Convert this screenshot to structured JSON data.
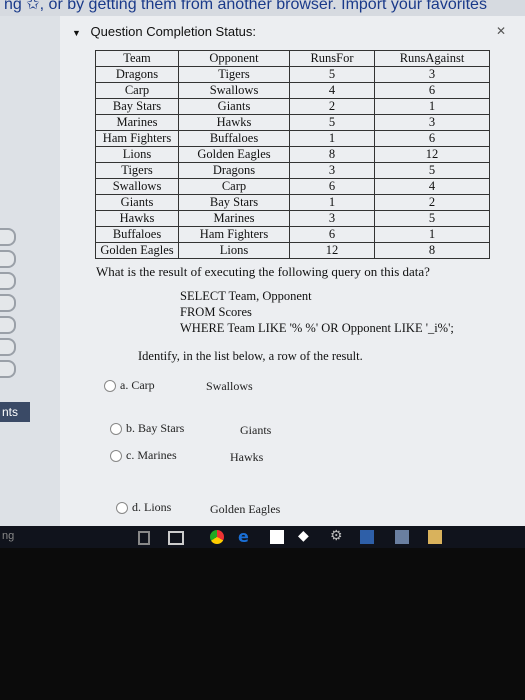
{
  "browser_strip_text": "ng ✩, or by getting them from another browser. Import your favorites",
  "side_label": "nts",
  "taskbar_left_text": "ng",
  "header": {
    "title": "Question Completion Status:"
  },
  "table": {
    "columns": [
      "Team",
      "Opponent",
      "RunsFor",
      "RunsAgainst"
    ],
    "rows": [
      [
        "Dragons",
        "Tigers",
        "5",
        "3"
      ],
      [
        "Carp",
        "Swallows",
        "4",
        "6"
      ],
      [
        "Bay Stars",
        "Giants",
        "2",
        "1"
      ],
      [
        "Marines",
        "Hawks",
        "5",
        "3"
      ],
      [
        "Ham Fighters",
        "Buffaloes",
        "1",
        "6"
      ],
      [
        "Lions",
        "Golden Eagles",
        "8",
        "12"
      ],
      [
        "Tigers",
        "Dragons",
        "3",
        "5"
      ],
      [
        "Swallows",
        "Carp",
        "6",
        "4"
      ],
      [
        "Giants",
        "Bay Stars",
        "1",
        "2"
      ],
      [
        "Hawks",
        "Marines",
        "3",
        "5"
      ],
      [
        "Buffaloes",
        "Ham Fighters",
        "6",
        "1"
      ],
      [
        "Golden Eagles",
        "Lions",
        "12",
        "8"
      ]
    ]
  },
  "question": {
    "prompt": "What is the result of executing the following query on this data?",
    "query_line1": "SELECT Team, Opponent",
    "query_line2": "FROM Scores",
    "query_line3": "WHERE Team LIKE '% %' OR Opponent LIKE '_i%';",
    "identify": "Identify, in the list below, a row of the result."
  },
  "options": [
    {
      "letter": "a.",
      "team": "Carp",
      "opponent": "Swallows"
    },
    {
      "letter": "b.",
      "team": "Bay Stars",
      "opponent": "Giants"
    },
    {
      "letter": "c.",
      "team": "Marines",
      "opponent": "Hawks"
    },
    {
      "letter": "d.",
      "team": "Lions",
      "opponent": "Golden Eagles"
    }
  ],
  "taskbar_icons": [
    "file-icon",
    "task-view-icon",
    "chrome-icon",
    "edge-icon",
    "store-icon",
    "teamviewer-icon",
    "settings-icon",
    "app-icon",
    "folder-icon"
  ],
  "colors": {
    "panel": "#eceef1",
    "taskbar": "#10131c",
    "accent_blue": "#1a6fd6"
  }
}
